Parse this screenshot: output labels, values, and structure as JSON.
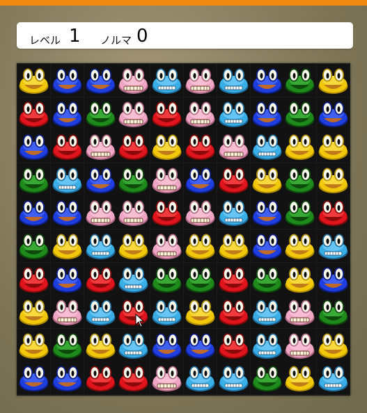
{
  "header": {
    "level_label": "レベル",
    "level_value": "1",
    "quota_label": "ノルマ",
    "quota_value": "0"
  },
  "colors": {
    "accent_bar": "#f08a12",
    "pieces": {
      "Y": {
        "base": "#f2c80a",
        "light": "#ffe96a",
        "dark": "#b38f00",
        "mouth": "#c07a1a"
      },
      "B": {
        "base": "#1e3ee0",
        "light": "#5b7bff",
        "dark": "#0d1f8a",
        "mouth": "#c06a2a"
      },
      "P": {
        "base": "#efa6c4",
        "light": "#ffd2e2",
        "dark": "#b36a86",
        "mouth": "#6a3a2a"
      },
      "C": {
        "base": "#3aaee6",
        "light": "#8ad8ff",
        "dark": "#1f6ea0",
        "mouth": "#ffffff"
      },
      "R": {
        "base": "#e0141c",
        "light": "#ff5a5a",
        "dark": "#8a0a0a",
        "mouth": "#8a0a0a"
      },
      "G": {
        "base": "#1f8a1c",
        "light": "#4cc24a",
        "dark": "#0d4a0c",
        "mouth": "#0d4a0c"
      }
    }
  },
  "board": {
    "rows": [
      [
        "Y",
        "B",
        "B",
        "P",
        "C",
        "P",
        "C",
        "B",
        "G",
        "Y"
      ],
      [
        "R",
        "B",
        "G",
        "P",
        "R",
        "P",
        "C",
        "B",
        "G",
        "B"
      ],
      [
        "B",
        "R",
        "P",
        "R",
        "Y",
        "R",
        "P",
        "C",
        "Y",
        "Y"
      ],
      [
        "G",
        "C",
        "B",
        "G",
        "P",
        "B",
        "R",
        "Y",
        "G",
        "Y"
      ],
      [
        "B",
        "B",
        "P",
        "P",
        "R",
        "P",
        "C",
        "B",
        "G",
        "R"
      ],
      [
        "G",
        "Y",
        "C",
        "Y",
        "P",
        "Y",
        "Y",
        "B",
        "Y",
        "C"
      ],
      [
        "R",
        "B",
        "R",
        "C",
        "G",
        "G",
        "R",
        "G",
        "Y",
        "B"
      ],
      [
        "Y",
        "P",
        "C",
        "R",
        "C",
        "Y",
        "R",
        "C",
        "P",
        "G"
      ],
      [
        "Y",
        "G",
        "Y",
        "C",
        "B",
        "B",
        "R",
        "C",
        "P",
        "Y"
      ],
      [
        "B",
        "B",
        "R",
        "R",
        "P",
        "C",
        "C",
        "G",
        "Y",
        "C"
      ]
    ]
  }
}
